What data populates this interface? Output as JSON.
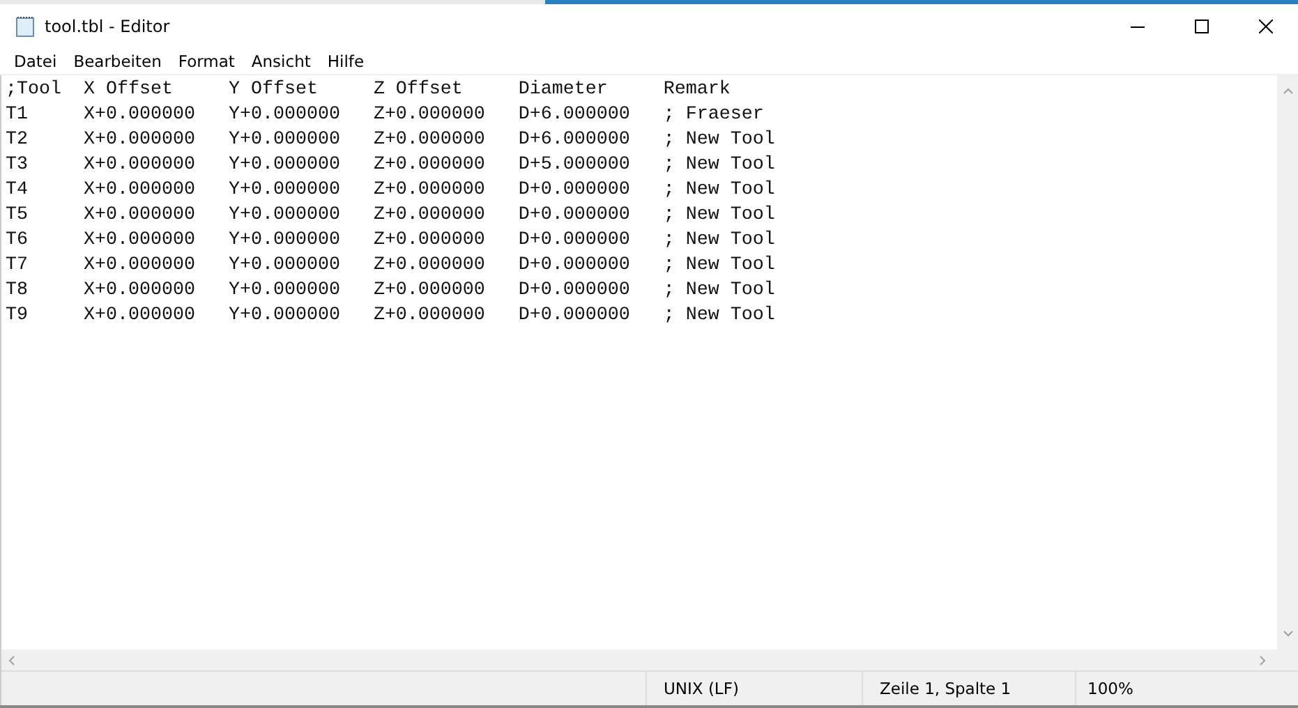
{
  "window": {
    "title": "tool.tbl - Editor"
  },
  "menu": [
    "Datei",
    "Bearbeiten",
    "Format",
    "Ansicht",
    "Hilfe"
  ],
  "editor": {
    "lines": [
      ";Tool  X Offset     Y Offset     Z Offset     Diameter     Remark",
      "T1     X+0.000000   Y+0.000000   Z+0.000000   D+6.000000   ; Fraeser",
      "T2     X+0.000000   Y+0.000000   Z+0.000000   D+6.000000   ; New Tool",
      "T3     X+0.000000   Y+0.000000   Z+0.000000   D+5.000000   ; New Tool",
      "T4     X+0.000000   Y+0.000000   Z+0.000000   D+0.000000   ; New Tool",
      "T5     X+0.000000   Y+0.000000   Z+0.000000   D+0.000000   ; New Tool",
      "T6     X+0.000000   Y+0.000000   Z+0.000000   D+0.000000   ; New Tool",
      "T7     X+0.000000   Y+0.000000   Z+0.000000   D+0.000000   ; New Tool",
      "T8     X+0.000000   Y+0.000000   Z+0.000000   D+0.000000   ; New Tool",
      "T9     X+0.000000   Y+0.000000   Z+0.000000   D+0.000000   ; New Tool"
    ]
  },
  "status_bar": {
    "encoding": "UNIX (LF)",
    "position": "Zeile 1, Spalte 1",
    "zoom": "100%"
  }
}
